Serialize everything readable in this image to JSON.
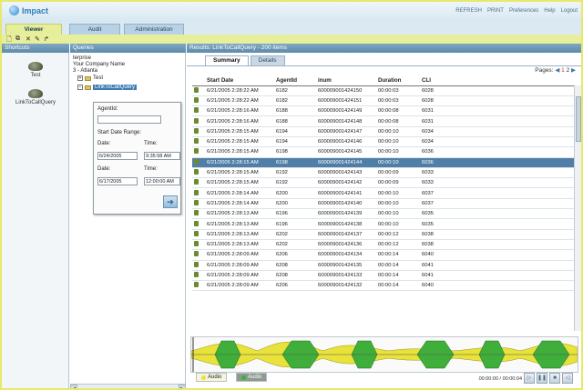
{
  "app": {
    "logo": "Impact",
    "top_links": [
      "REFRESH",
      "PRINT",
      "Preferences",
      "Help",
      "Logout"
    ]
  },
  "tabs": [
    {
      "label": "Viewer",
      "active": true
    },
    {
      "label": "Audit",
      "active": false
    },
    {
      "label": "Administration",
      "active": false
    }
  ],
  "panels": {
    "shortcuts": "Shortcuts",
    "queries": "Queries",
    "results": "Results: LinkToCallQuery - 200 items"
  },
  "shortcuts": [
    {
      "label": "Test",
      "icon": "phone-icon"
    },
    {
      "label": "LinkToCallQuery",
      "icon": "phone-icon"
    }
  ],
  "queries": {
    "lines": [
      "terprise",
      "Your Company Name",
      "3 - Atlanta"
    ],
    "nodes": [
      "Test",
      "LinkToCallQuery"
    ],
    "box": {
      "agent_label": "AgentId:",
      "agent_value": "",
      "range_label": "Start Date Range:",
      "date_label": "Date:",
      "time_label": "Time:",
      "from_date": "6/24/2005",
      "from_time": "9:35:58 AM",
      "to_date": "6/17/2005",
      "to_time": "12:00:00 AM"
    }
  },
  "results": {
    "tabs": [
      "Summary",
      "Details"
    ],
    "pages": {
      "label": "Pages:",
      "current": "1",
      "next": "2"
    },
    "columns": [
      "Start Date",
      "AgentId",
      "inum",
      "Duration",
      "CLI"
    ],
    "rows": [
      [
        "6/21/2005 2:28:22 AM",
        "6182",
        "600009001424150",
        "00:00:03",
        "6028"
      ],
      [
        "6/21/2005 2:28:22 AM",
        "6182",
        "600009001424151",
        "00:00:03",
        "6028"
      ],
      [
        "6/21/2005 2:28:16 AM",
        "6188",
        "600009001424149",
        "00:00:08",
        "6031"
      ],
      [
        "6/21/2005 2:28:16 AM",
        "6188",
        "600009001424148",
        "00:00:08",
        "6031"
      ],
      [
        "6/21/2005 2:28:15 AM",
        "6194",
        "600009001424147",
        "00:00:10",
        "6034"
      ],
      [
        "6/21/2005 2:28:15 AM",
        "6194",
        "600009001424146",
        "00:00:10",
        "6034"
      ],
      [
        "6/21/2005 2:28:15 AM",
        "6198",
        "600009001424145",
        "00:00:10",
        "6036"
      ],
      [
        "6/21/2005 2:28:15 AM",
        "6198",
        "600009001424144",
        "00:00:10",
        "6036"
      ],
      [
        "6/21/2005 2:28:15 AM",
        "6192",
        "600009001424143",
        "00:00:09",
        "6033"
      ],
      [
        "6/21/2005 2:28:15 AM",
        "6192",
        "600009001424142",
        "00:00:09",
        "6033"
      ],
      [
        "6/21/2005 2:28:14 AM",
        "6200",
        "600009001424141",
        "00:00:10",
        "6037"
      ],
      [
        "6/21/2005 2:28:14 AM",
        "6200",
        "600009001424140",
        "00:00:10",
        "6037"
      ],
      [
        "6/21/2005 2:28:13 AM",
        "6196",
        "600009001424139",
        "00:00:10",
        "6035"
      ],
      [
        "6/21/2005 2:28:13 AM",
        "6196",
        "600009001424138",
        "00:00:10",
        "6035"
      ],
      [
        "6/21/2005 2:28:13 AM",
        "6202",
        "600009001424137",
        "00:00:12",
        "6038"
      ],
      [
        "6/21/2005 2:28:13 AM",
        "6202",
        "600009001424136",
        "00:00:12",
        "6038"
      ],
      [
        "6/21/2005 2:28:09 AM",
        "6206",
        "600009001424134",
        "00:00:14",
        "6040"
      ],
      [
        "6/21/2005 2:28:09 AM",
        "6208",
        "600009001424135",
        "00:00:14",
        "6041"
      ],
      [
        "6/21/2005 2:28:09 AM",
        "6208",
        "600009001424133",
        "00:00:14",
        "6041"
      ],
      [
        "6/21/2005 2:28:09 AM",
        "6206",
        "600009001424132",
        "00:00:14",
        "6040"
      ]
    ],
    "selected_row": 7
  },
  "player": {
    "tabs": [
      "Audio",
      "Audio"
    ],
    "time": "00:00:00 / 00:00:04",
    "colors": {
      "wave_primary": "#e8e23a",
      "wave_secondary": "#3fae3a"
    }
  }
}
